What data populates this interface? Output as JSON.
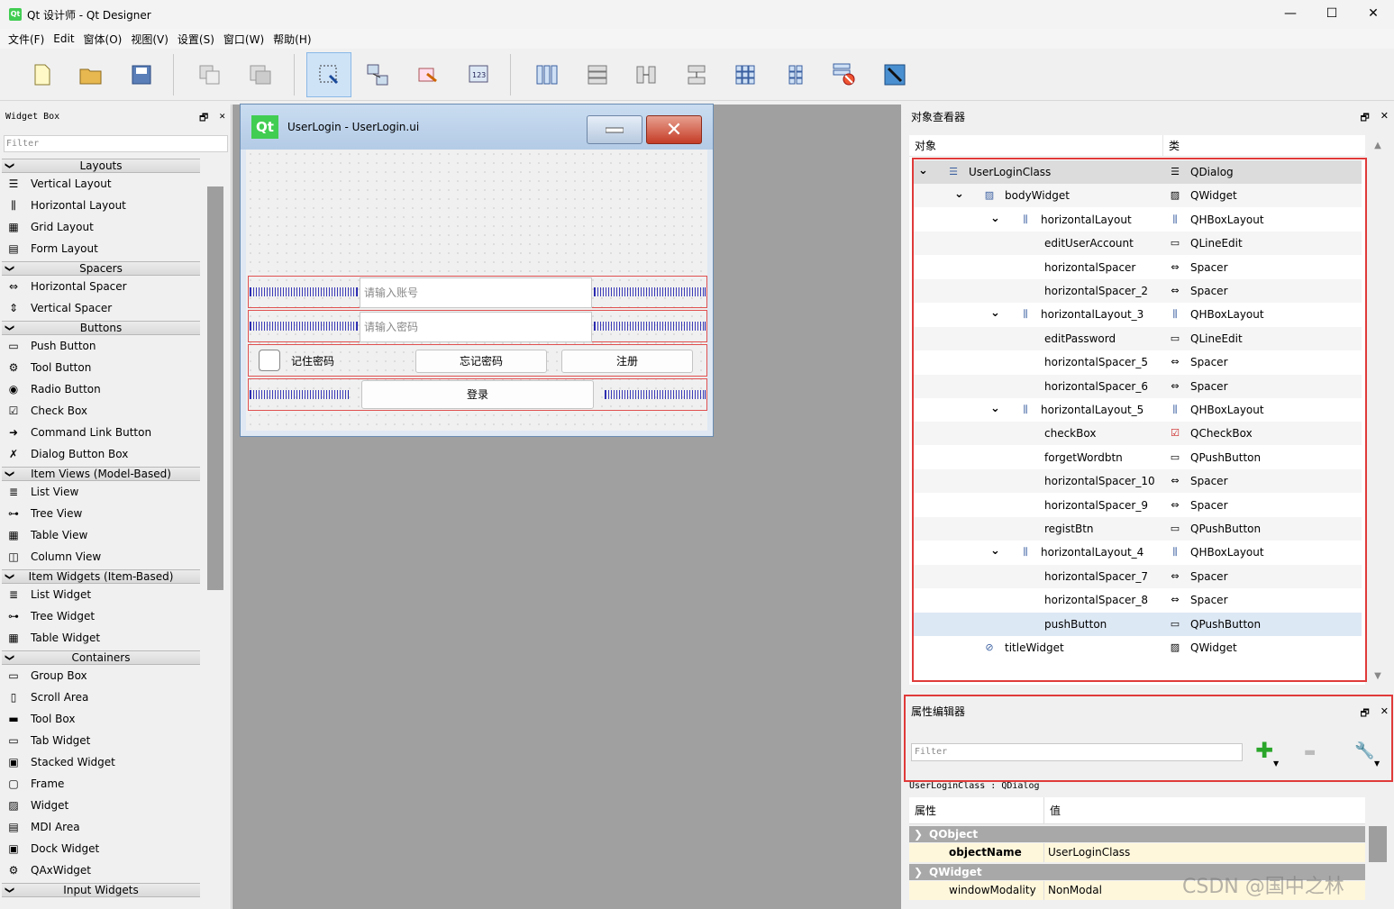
{
  "window": {
    "title": "Qt 设计师 - Qt Designer",
    "app_icon": "Qt",
    "minimize": "—",
    "maximize": "☐",
    "close": "✕"
  },
  "menu": [
    "文件(F)",
    "Edit",
    "窗体(O)",
    "视图(V)",
    "设置(S)",
    "窗口(W)",
    "帮助(H)"
  ],
  "toolbar": {
    "icons": [
      "new-file-icon",
      "open-folder-icon",
      "save-icon",
      "copy-icon",
      "paste-icon",
      "edit-widgets-icon",
      "edit-signals-icon",
      "edit-buddies-icon",
      "edit-tab-order-icon",
      "horizontal-layout-icon",
      "vertical-layout-icon",
      "horizontal-splitter-icon",
      "vertical-splitter-icon",
      "grid-layout-icon",
      "form-layout-icon",
      "break-layout-icon",
      "adjust-size-icon"
    ]
  },
  "widget_box": {
    "title": "Widget Box",
    "float": "🗗",
    "close": "✕",
    "filter_placeholder": "Filter",
    "categories": [
      {
        "name": "Layouts",
        "items": [
          "Vertical Layout",
          "Horizontal Layout",
          "Grid Layout",
          "Form Layout"
        ]
      },
      {
        "name": "Spacers",
        "items": [
          "Horizontal Spacer",
          "Vertical Spacer"
        ]
      },
      {
        "name": "Buttons",
        "items": [
          "Push Button",
          "Tool Button",
          "Radio Button",
          "Check Box",
          "Command Link Button",
          "Dialog Button Box"
        ]
      },
      {
        "name": "Item Views (Model-Based)",
        "items": [
          "List View",
          "Tree View",
          "Table View",
          "Column View"
        ]
      },
      {
        "name": "Item Widgets (Item-Based)",
        "items": [
          "List Widget",
          "Tree Widget",
          "Table Widget"
        ]
      },
      {
        "name": "Containers",
        "items": [
          "Group Box",
          "Scroll Area",
          "Tool Box",
          "Tab Widget",
          "Stacked Widget",
          "Frame",
          "Widget",
          "MDI Area",
          "Dock Widget",
          "QAxWidget"
        ]
      },
      {
        "name": "Input Widgets",
        "items": []
      }
    ]
  },
  "form": {
    "logo": "Qt",
    "title": "UserLogin - UserLogin.ui",
    "account_placeholder": "请输入账号",
    "password_placeholder": "请输入密码",
    "remember_label": "记住密码",
    "forget_label": "忘记密码",
    "register_label": "注册",
    "login_label": "登录"
  },
  "object_inspector": {
    "title": "对象查看器",
    "col_object": "对象",
    "col_class": "类",
    "rows": [
      {
        "name": "UserLoginClass",
        "class": "QDialog",
        "level": 0,
        "expanded": true
      },
      {
        "name": "bodyWidget",
        "class": "QWidget",
        "level": 1,
        "expanded": true
      },
      {
        "name": "horizontalLayout",
        "class": "QHBoxLayout",
        "level": 2,
        "expanded": true
      },
      {
        "name": "editUserAccount",
        "class": "QLineEdit",
        "level": 3
      },
      {
        "name": "horizontalSpacer",
        "class": "Spacer",
        "level": 3
      },
      {
        "name": "horizontalSpacer_2",
        "class": "Spacer",
        "level": 3
      },
      {
        "name": "horizontalLayout_3",
        "class": "QHBoxLayout",
        "level": 2,
        "expanded": true
      },
      {
        "name": "editPassword",
        "class": "QLineEdit",
        "level": 3
      },
      {
        "name": "horizontalSpacer_5",
        "class": "Spacer",
        "level": 3
      },
      {
        "name": "horizontalSpacer_6",
        "class": "Spacer",
        "level": 3
      },
      {
        "name": "horizontalLayout_5",
        "class": "QHBoxLayout",
        "level": 2,
        "expanded": true
      },
      {
        "name": "checkBox",
        "class": "QCheckBox",
        "level": 3
      },
      {
        "name": "forgetWordbtn",
        "class": "QPushButton",
        "level": 3
      },
      {
        "name": "horizontalSpacer_10",
        "class": "Spacer",
        "level": 3
      },
      {
        "name": "horizontalSpacer_9",
        "class": "Spacer",
        "level": 3
      },
      {
        "name": "registBtn",
        "class": "QPushButton",
        "level": 3
      },
      {
        "name": "horizontalLayout_4",
        "class": "QHBoxLayout",
        "level": 2,
        "expanded": true
      },
      {
        "name": "horizontalSpacer_7",
        "class": "Spacer",
        "level": 3
      },
      {
        "name": "horizontalSpacer_8",
        "class": "Spacer",
        "level": 3
      },
      {
        "name": "pushButton",
        "class": "QPushButton",
        "level": 3
      },
      {
        "name": "titleWidget",
        "class": "QWidget",
        "level": 1
      }
    ]
  },
  "property_editor": {
    "title": "属性编辑器",
    "filter_placeholder": "Filter",
    "subtitle": "UserLoginClass : QDialog",
    "col_property": "属性",
    "col_value": "值",
    "groups": [
      {
        "name": "QObject",
        "props": [
          {
            "key": "objectName",
            "value": "UserLoginClass"
          }
        ]
      },
      {
        "name": "QWidget",
        "props": [
          {
            "key": "windowModality",
            "value": "NonModal"
          }
        ]
      }
    ],
    "add": "✚",
    "remove": "▬",
    "configure": "🔧"
  },
  "watermark": "CSDN @国中之林"
}
